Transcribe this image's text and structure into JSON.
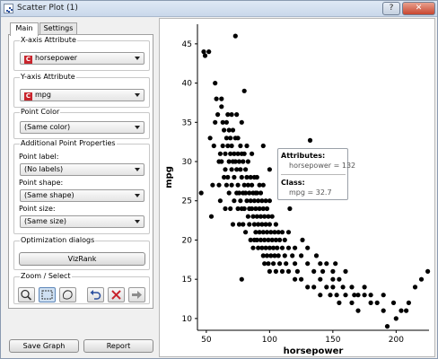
{
  "window": {
    "title": "Scatter Plot (1)",
    "help_label": "?",
    "close_label": "✕"
  },
  "tabs": [
    {
      "label": "Main",
      "active": true
    },
    {
      "label": "Settings",
      "active": false
    }
  ],
  "sidebar": {
    "x_axis": {
      "title": "X-axis Attribute",
      "value": "horsepower",
      "icon_letter": "C"
    },
    "y_axis": {
      "title": "Y-axis Attribute",
      "value": "mpg",
      "icon_letter": "C"
    },
    "point_color": {
      "title": "Point Color",
      "value": "(Same color)"
    },
    "additional": {
      "title": "Additional Point Properties",
      "label_label": "Point label:",
      "label_value": "(No labels)",
      "shape_label": "Point shape:",
      "shape_value": "(Same shape)",
      "size_label": "Point size:",
      "size_value": "(Same size)"
    },
    "optimization": {
      "title": "Optimization dialogs",
      "button_label": "VizRank"
    },
    "zoom_select": {
      "title": "Zoom / Select",
      "tools": [
        "zoom-icon",
        "rectangle-select-icon",
        "lasso-select-icon",
        "undo-icon",
        "delete-icon",
        "send-selection-icon"
      ],
      "active_tool": "rectangle-select-icon"
    }
  },
  "footer": {
    "save_label": "Save Graph",
    "report_label": "Report"
  },
  "tooltip": {
    "attributes_title": "Attributes:",
    "attributes_value": "horsepower = 132",
    "class_title": "Class:",
    "class_value": "mpg = 32.7"
  },
  "colors": {
    "point": "#000000",
    "icon_red": "#c8242c",
    "selected_tool": "#cfe0f2"
  },
  "chart_data": {
    "type": "scatter",
    "xlabel": "horsepower",
    "ylabel": "mpg",
    "xlim": [
      43,
      226
    ],
    "ylim": [
      8.5,
      47.5
    ],
    "xticks": [
      50,
      100,
      150,
      200
    ],
    "yticks": [
      10,
      15,
      20,
      25,
      30,
      35,
      40,
      45
    ],
    "grid": false,
    "points": [
      [
        46,
        26
      ],
      [
        48,
        44
      ],
      [
        49,
        43.5
      ],
      [
        52,
        44
      ],
      [
        53,
        33
      ],
      [
        54,
        23
      ],
      [
        55,
        27
      ],
      [
        56,
        32
      ],
      [
        57,
        35
      ],
      [
        58,
        38
      ],
      [
        59,
        36
      ],
      [
        60,
        30
      ],
      [
        60,
        27
      ],
      [
        61,
        31
      ],
      [
        61,
        25
      ],
      [
        62,
        30
      ],
      [
        62,
        37
      ],
      [
        63,
        35
      ],
      [
        63,
        32
      ],
      [
        64,
        28
      ],
      [
        64,
        34
      ],
      [
        65,
        29
      ],
      [
        65,
        31
      ],
      [
        65,
        24
      ],
      [
        66,
        33
      ],
      [
        66,
        27
      ],
      [
        66,
        35
      ],
      [
        67,
        32
      ],
      [
        67,
        36
      ],
      [
        67,
        28
      ],
      [
        68,
        30
      ],
      [
        68,
        26
      ],
      [
        68,
        34
      ],
      [
        69,
        31
      ],
      [
        69,
        33
      ],
      [
        69,
        24
      ],
      [
        70,
        32
      ],
      [
        70,
        29
      ],
      [
        70,
        36
      ],
      [
        70,
        27
      ],
      [
        71,
        30
      ],
      [
        71,
        34
      ],
      [
        71,
        22
      ],
      [
        72,
        31
      ],
      [
        72,
        28
      ],
      [
        72,
        25
      ],
      [
        73,
        33
      ],
      [
        73,
        30
      ],
      [
        73,
        46
      ],
      [
        74,
        29
      ],
      [
        74,
        26
      ],
      [
        74,
        36
      ],
      [
        75,
        31
      ],
      [
        75,
        27
      ],
      [
        75,
        24
      ],
      [
        75,
        33
      ],
      [
        76,
        30
      ],
      [
        76,
        26
      ],
      [
        76,
        22
      ],
      [
        77,
        29
      ],
      [
        77,
        32
      ],
      [
        77,
        25
      ],
      [
        78,
        28
      ],
      [
        78,
        24
      ],
      [
        78,
        31
      ],
      [
        78,
        35
      ],
      [
        79,
        26
      ],
      [
        79,
        30
      ],
      [
        79,
        22
      ],
      [
        80,
        27
      ],
      [
        80,
        24
      ],
      [
        80,
        31
      ],
      [
        80,
        39
      ],
      [
        81,
        26
      ],
      [
        81,
        29
      ],
      [
        81,
        21
      ],
      [
        82,
        28
      ],
      [
        82,
        25
      ],
      [
        82,
        32
      ],
      [
        83,
        27
      ],
      [
        83,
        23
      ],
      [
        83,
        30
      ],
      [
        84,
        26
      ],
      [
        84,
        24
      ],
      [
        84,
        22
      ],
      [
        85,
        25
      ],
      [
        85,
        28
      ],
      [
        85,
        20
      ],
      [
        86,
        27
      ],
      [
        86,
        24
      ],
      [
        86,
        31
      ],
      [
        87,
        23
      ],
      [
        87,
        26
      ],
      [
        87,
        19
      ],
      [
        88,
        25
      ],
      [
        88,
        22
      ],
      [
        88,
        28
      ],
      [
        88,
        20
      ],
      [
        89,
        24
      ],
      [
        89,
        21
      ],
      [
        89,
        26
      ],
      [
        90,
        23
      ],
      [
        90,
        20
      ],
      [
        90,
        26
      ],
      [
        90,
        28
      ],
      [
        91,
        22
      ],
      [
        91,
        25
      ],
      [
        91,
        19
      ],
      [
        92,
        24
      ],
      [
        92,
        21
      ],
      [
        92,
        27
      ],
      [
        93,
        23
      ],
      [
        93,
        20
      ],
      [
        93,
        26
      ],
      [
        94,
        22
      ],
      [
        94,
        19
      ],
      [
        94,
        25
      ],
      [
        95,
        21
      ],
      [
        95,
        24
      ],
      [
        95,
        18
      ],
      [
        95,
        27
      ],
      [
        96,
        20
      ],
      [
        96,
        23
      ],
      [
        96,
        17
      ],
      [
        97,
        22
      ],
      [
        97,
        19
      ],
      [
        97,
        25
      ],
      [
        98,
        21
      ],
      [
        98,
        18
      ],
      [
        98,
        24
      ],
      [
        99,
        20
      ],
      [
        99,
        23
      ],
      [
        99,
        17
      ],
      [
        100,
        22
      ],
      [
        100,
        19
      ],
      [
        100,
        25
      ],
      [
        100,
        16
      ],
      [
        101,
        21
      ],
      [
        101,
        18
      ],
      [
        102,
        20
      ],
      [
        102,
        23
      ],
      [
        103,
        19
      ],
      [
        103,
        17
      ],
      [
        104,
        21
      ],
      [
        104,
        18
      ],
      [
        105,
        20
      ],
      [
        105,
        22
      ],
      [
        105,
        16
      ],
      [
        106,
        19
      ],
      [
        107,
        21
      ],
      [
        107,
        18
      ],
      [
        108,
        20
      ],
      [
        108,
        17
      ],
      [
        110,
        19
      ],
      [
        110,
        21
      ],
      [
        110,
        16
      ],
      [
        112,
        18
      ],
      [
        112,
        20
      ],
      [
        113,
        17
      ],
      [
        115,
        19
      ],
      [
        115,
        16
      ],
      [
        115,
        21
      ],
      [
        116,
        24
      ],
      [
        118,
        18
      ],
      [
        120,
        17
      ],
      [
        120,
        19
      ],
      [
        120,
        15
      ],
      [
        122,
        16
      ],
      [
        125,
        18
      ],
      [
        125,
        15
      ],
      [
        126,
        20
      ],
      [
        130,
        17
      ],
      [
        130,
        14
      ],
      [
        130,
        19
      ],
      [
        132,
        32.7
      ],
      [
        135,
        16
      ],
      [
        135,
        14
      ],
      [
        137,
        18
      ],
      [
        140,
        15
      ],
      [
        140,
        17
      ],
      [
        140,
        13
      ],
      [
        142,
        16
      ],
      [
        145,
        14
      ],
      [
        145,
        17
      ],
      [
        148,
        13
      ],
      [
        150,
        15
      ],
      [
        150,
        16
      ],
      [
        150,
        14
      ],
      [
        152,
        17
      ],
      [
        153,
        13
      ],
      [
        155,
        15
      ],
      [
        155,
        12
      ],
      [
        158,
        14
      ],
      [
        160,
        13
      ],
      [
        160,
        16
      ],
      [
        165,
        14
      ],
      [
        165,
        12
      ],
      [
        167,
        13
      ],
      [
        170,
        13
      ],
      [
        170,
        11
      ],
      [
        175,
        13
      ],
      [
        175,
        14
      ],
      [
        180,
        12
      ],
      [
        180,
        13
      ],
      [
        185,
        12
      ],
      [
        190,
        11
      ],
      [
        190,
        13
      ],
      [
        193,
        9
      ],
      [
        198,
        12
      ],
      [
        200,
        10
      ],
      [
        204,
        11
      ],
      [
        208,
        11
      ],
      [
        210,
        12
      ],
      [
        215,
        14
      ],
      [
        220,
        15
      ],
      [
        225,
        16
      ],
      [
        78,
        15
      ],
      [
        120,
        30
      ],
      [
        110,
        28
      ],
      [
        57,
        40
      ],
      [
        62,
        38
      ],
      [
        95,
        32
      ],
      [
        100,
        29
      ]
    ]
  }
}
